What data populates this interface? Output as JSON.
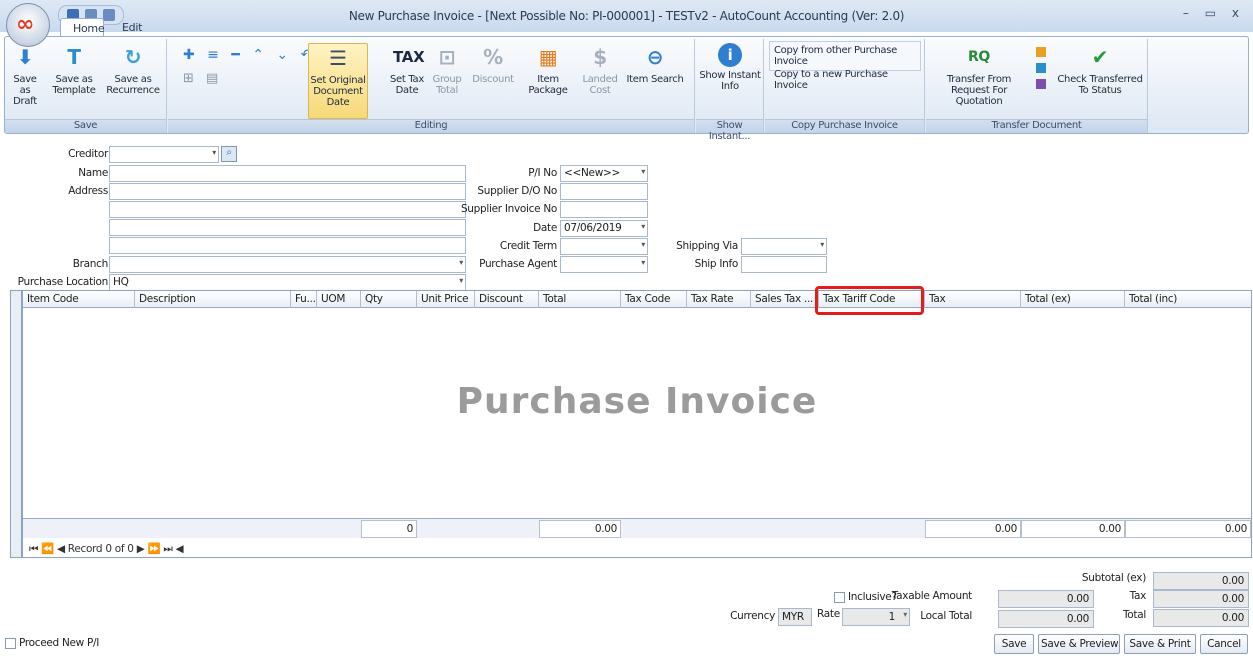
{
  "window": {
    "title": "New Purchase Invoice - [Next Possible No: PI-000001] - TESTv2 - AutoCount Accounting (Ver: 2.0)",
    "controls": "– ▭ x"
  },
  "tabs": [
    {
      "label": "Home"
    },
    {
      "label": "Edit"
    }
  ],
  "ribbon": {
    "groups": {
      "save": "Save",
      "editing": "Editing",
      "show_instant": "Show Instant...",
      "copy": "Copy Purchase Invoice",
      "transfer": "Transfer Document"
    },
    "buttons": {
      "save_draft": "Save as Draft",
      "save_template": "Save as Template",
      "save_recurrence": "Save as Recurrence",
      "set_original_date": "Set Original Document Date",
      "set_tax_date": "Set Tax Date",
      "group_total": "Group Total",
      "discount": "Discount",
      "item_package": "Item Package",
      "landed_cost": "Landed Cost",
      "item_search": "Item Search",
      "show_instant_info": "Show Instant Info",
      "copy_from_other": "Copy from other Purchase Invoice",
      "copy_to_new": "Copy to a new Purchase Invoice",
      "transfer_rfq": "Transfer From Request For Quotation",
      "check_transferred": "Check Transferred To Status"
    }
  },
  "form": {
    "creditor_label": "Creditor",
    "name_label": "Name",
    "address_label": "Address",
    "branch_label": "Branch",
    "purchase_location_label": "Purchase Location",
    "purchase_location_value": "HQ",
    "pi_no_label": "P/I No",
    "pi_no_value": "<<New>>",
    "supplier_do_label": "Supplier D/O No",
    "supplier_invoice_label": "Supplier Invoice No",
    "date_label": "Date",
    "date_value": "07/06/2019",
    "credit_term_label": "Credit Term",
    "purchase_agent_label": "Purchase Agent",
    "shipping_via_label": "Shipping Via",
    "ship_info_label": "Ship Info"
  },
  "grid": {
    "columns": [
      "Item Code",
      "Description",
      "Fu...",
      "UOM",
      "Qty",
      "Unit Price",
      "Discount",
      "Total",
      "Tax Code",
      "Tax Rate",
      "Sales Tax ...",
      "Tax Tariff Code",
      "Tax",
      "Total (ex)",
      "Total (inc)"
    ],
    "watermark": "Purchase Invoice",
    "footer": {
      "qty": "0",
      "total": "0.00",
      "tax": "0.00",
      "total_ex": "0.00",
      "total_inc": "0.00"
    },
    "navigator": "⏮ ⏪ ◀ Record 0 of 0 ▶ ⏩ ⏭ ◀"
  },
  "totals": {
    "inclusive_label": "Inclusive?",
    "taxable_amount_label": "Taxable Amount",
    "taxable_amount_value": "0.00",
    "local_total_label": "Local Total",
    "local_total_value": "0.00",
    "currency_label": "Currency",
    "currency_value": "MYR",
    "rate_label": "Rate",
    "rate_value": "1",
    "subtotal_label": "Subtotal (ex)",
    "subtotal_value": "0.00",
    "tax_label": "Tax",
    "tax_value": "0.00",
    "total_label": "Total",
    "total_value": "0.00"
  },
  "bottom": {
    "proceed_new": "Proceed New P/I",
    "save": "Save",
    "save_preview": "Save & Preview",
    "save_print": "Save & Print",
    "cancel": "Cancel"
  },
  "colors": {
    "highlight": "#e31d1d",
    "accent": "#3d6fb5"
  }
}
